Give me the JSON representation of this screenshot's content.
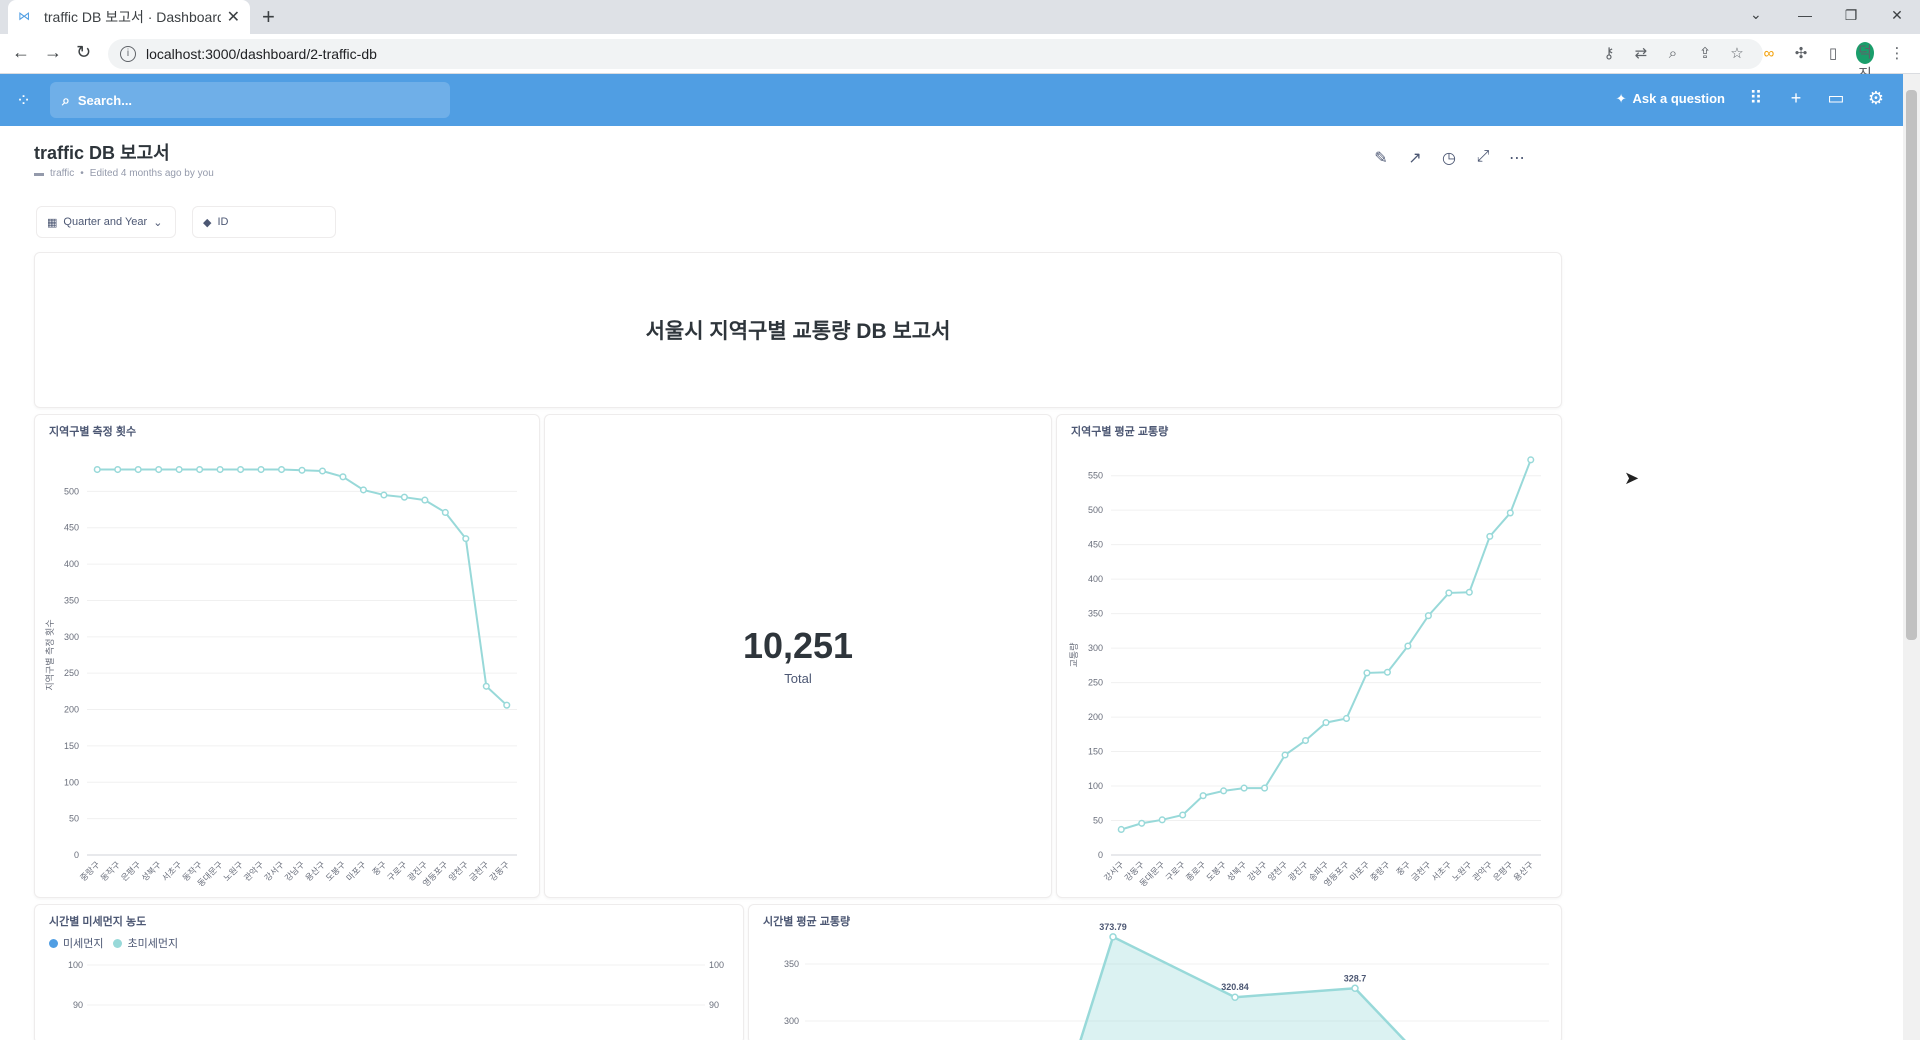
{
  "browser": {
    "tab_title": "traffic DB 보고서 · Dashboard",
    "tab_favicon": "metabase-icon",
    "url": "localhost:3000/dashboard/2-traffic-db",
    "profile_initials": "덕진"
  },
  "nav": {
    "search_placeholder": "Search...",
    "ask_question": "Ask a question"
  },
  "dashboard": {
    "title": "traffic DB 보고서",
    "collection": "traffic",
    "edited": "Edited 4 months ago by you",
    "filters": [
      "Quarter and Year",
      "ID"
    ]
  },
  "cards": {
    "heading": "서울시 지역구별 교통량 DB 보고서",
    "chart1_title": "지역구별 측정 횟수",
    "scalar_value": "10,251",
    "scalar_label": "Total",
    "chart3_title": "지역구별 평균 교통량",
    "chart4_title": "시간별 미세먼지 농도",
    "chart4_legend": [
      "미세먼지",
      "초미세먼지"
    ],
    "chart5_title": "시간별 평균 교통량"
  },
  "colors": {
    "brand": "#509ee3",
    "series_teal": "#98d9d9",
    "series_blue": "#509ee3"
  },
  "chart_data": [
    {
      "type": "line",
      "title": "지역구별 측정 횟수",
      "ylabel": "지역구별 측정 횟수",
      "ylim": [
        0,
        550
      ],
      "yticks": [
        0,
        50,
        100,
        150,
        200,
        250,
        300,
        350,
        400,
        450,
        500
      ],
      "categories": [
        "중랑구",
        "동작구",
        "은평구",
        "성북구",
        "서초구",
        "동작구",
        "동대문구",
        "노원구",
        "관악구",
        "강서구",
        "강남구",
        "용산구",
        "도봉구",
        "마포구",
        "중구",
        "구로구",
        "광진구",
        "영등포구",
        "양천구",
        "금천구",
        "강동구"
      ],
      "values": [
        530,
        530,
        530,
        530,
        530,
        530,
        530,
        530,
        530,
        530,
        529,
        528,
        520,
        502,
        495,
        492,
        488,
        471,
        435,
        232,
        206
      ]
    },
    {
      "type": "line",
      "title": "지역구별 평균 교통량",
      "ylabel": "교통량",
      "ylim": [
        0,
        580
      ],
      "yticks": [
        0,
        50,
        100,
        150,
        200,
        250,
        300,
        350,
        400,
        450,
        500,
        550
      ],
      "categories": [
        "강서구",
        "강동구",
        "동대문구",
        "구로구",
        "종로구",
        "도봉구",
        "성북구",
        "강남구",
        "양천구",
        "광진구",
        "송파구",
        "영등포구",
        "마포구",
        "중랑구",
        "중구",
        "금천구",
        "서초구",
        "노원구",
        "관악구",
        "은평구",
        "용산구"
      ],
      "values": [
        37,
        46,
        51,
        58,
        86,
        93,
        97,
        97,
        145,
        166,
        192,
        198,
        264,
        265,
        303,
        347,
        380,
        381,
        462,
        496,
        573
      ]
    },
    {
      "type": "area",
      "title": "시간별 평균 교통량",
      "yticks": [
        300,
        350
      ],
      "labels": [
        "373.79",
        "320.84",
        "328.7"
      ],
      "values": [
        373.79,
        320.84,
        328.7
      ]
    },
    {
      "type": "line",
      "title": "시간별 미세먼지 농도",
      "series": [
        {
          "name": "미세먼지",
          "values": []
        },
        {
          "name": "초미세먼지",
          "values": []
        }
      ],
      "yticks_left": [
        90,
        100
      ],
      "yticks_right": [
        90,
        100
      ]
    }
  ]
}
